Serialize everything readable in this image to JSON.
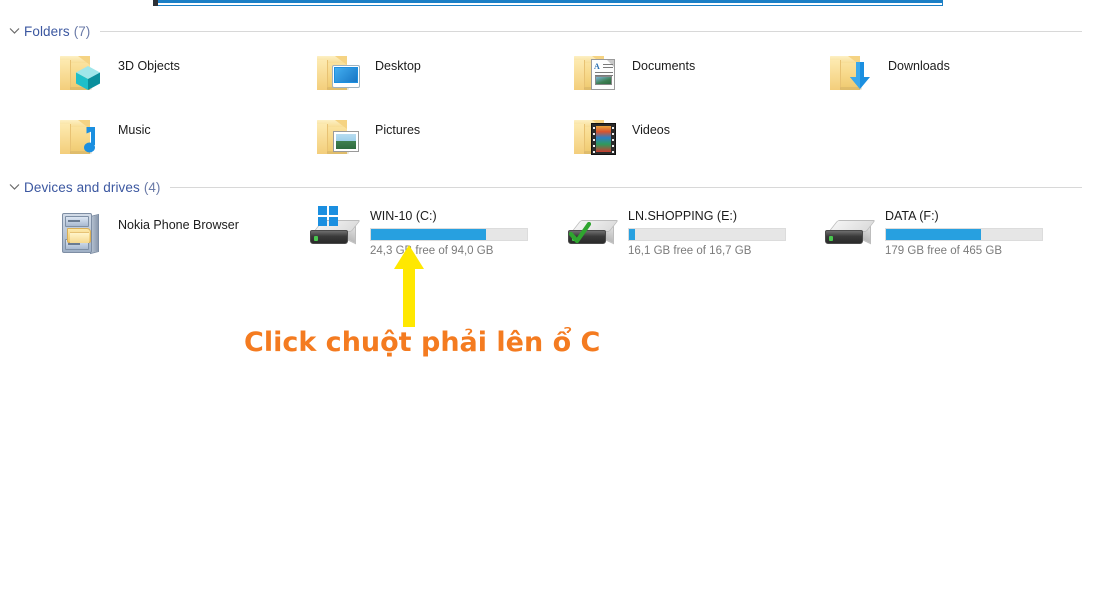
{
  "window": {
    "top_strip_color": "#1b7fc6"
  },
  "groups": [
    {
      "id": "folders",
      "title": "Folders",
      "count": "(7)",
      "chevron": "chevron-down-icon"
    },
    {
      "id": "devices",
      "title": "Devices and drives",
      "count": "(4)",
      "chevron": "chevron-down-icon"
    }
  ],
  "folders": [
    {
      "label": "3D Objects",
      "icon": "folder-3d-objects-icon"
    },
    {
      "label": "Desktop",
      "icon": "folder-desktop-icon"
    },
    {
      "label": "Documents",
      "icon": "folder-documents-icon"
    },
    {
      "label": "Downloads",
      "icon": "folder-downloads-icon"
    },
    {
      "label": "Music",
      "icon": "folder-music-icon"
    },
    {
      "label": "Pictures",
      "icon": "folder-pictures-icon"
    },
    {
      "label": "Videos",
      "icon": "folder-videos-icon"
    }
  ],
  "devices": [
    {
      "label": "Nokia Phone Browser",
      "icon": "file-cabinet-icon",
      "has_bar": false,
      "free_text": "",
      "used_percent": 0
    },
    {
      "label": "WIN-10 (C:)",
      "icon": "hard-drive-windows-icon",
      "has_bar": true,
      "free_text": "24,3 GB free of 94,0 GB",
      "used_percent": 74,
      "bar_color": "#27a0e0"
    },
    {
      "label": "LN.SHOPPING (E:)",
      "icon": "hard-drive-checked-icon",
      "has_bar": true,
      "free_text": "16,1 GB free of 16,7 GB",
      "used_percent": 4,
      "bar_color": "#27a0e0"
    },
    {
      "label": "DATA (F:)",
      "icon": "hard-drive-icon",
      "has_bar": true,
      "free_text": "179 GB free of 465 GB",
      "used_percent": 61,
      "bar_color": "#27a0e0"
    }
  ],
  "annotation": {
    "arrow_icon": "arrow-up-icon",
    "arrow_color": "#FFE800",
    "text": "Click chuột phải lên ổ C",
    "text_color": "#F47B20"
  }
}
